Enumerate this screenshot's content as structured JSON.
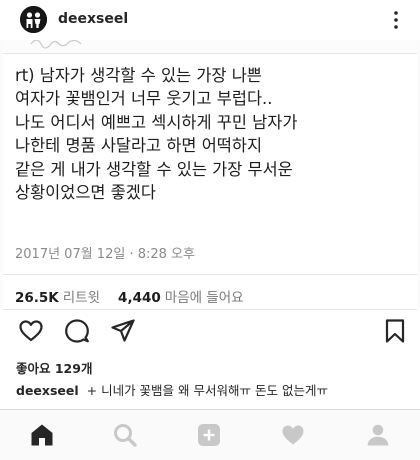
{
  "header": {
    "username": "deexseel"
  },
  "post": {
    "tweet_text": "rt) 남자가 생각할 수 있는 가장 나쁜\n여자가 꽃뱀인거 너무 웃기고 부럽다..\n나도 어디서 예쁘고 섹시하게 꾸민 남자가\n나한테 명품 사달라고 하면 어떡하지\n같은 게 내가 생각할 수 있는 가장 무서운\n상황이었으면 좋겠다",
    "tweet_date": "2017년 07월 12일 · 8:28 오후",
    "retweet_count": "26.5K",
    "retweet_label": "리트윗",
    "like_count": "4,440",
    "like_label": "마음에 들어요"
  },
  "likes_text": "좋아요 129개",
  "caption": {
    "user": "deexseel",
    "text": "+ 니네가 꽃뱀을 왜 무서워해ㅠ 돈도 없는게ㅠ"
  },
  "icons": {
    "like": "heart-icon",
    "comment": "comment-icon",
    "share": "send-icon",
    "save": "bookmark-icon",
    "more": "more-vertical-icon",
    "nav_home": "home-icon",
    "nav_search": "search-icon",
    "nav_add": "add-post-icon",
    "nav_activity": "heart-icon",
    "nav_profile": "profile-icon"
  },
  "colors": {
    "text": "#262626",
    "muted": "#8a8a8a",
    "nav_inactive": "#c8c8c8"
  }
}
